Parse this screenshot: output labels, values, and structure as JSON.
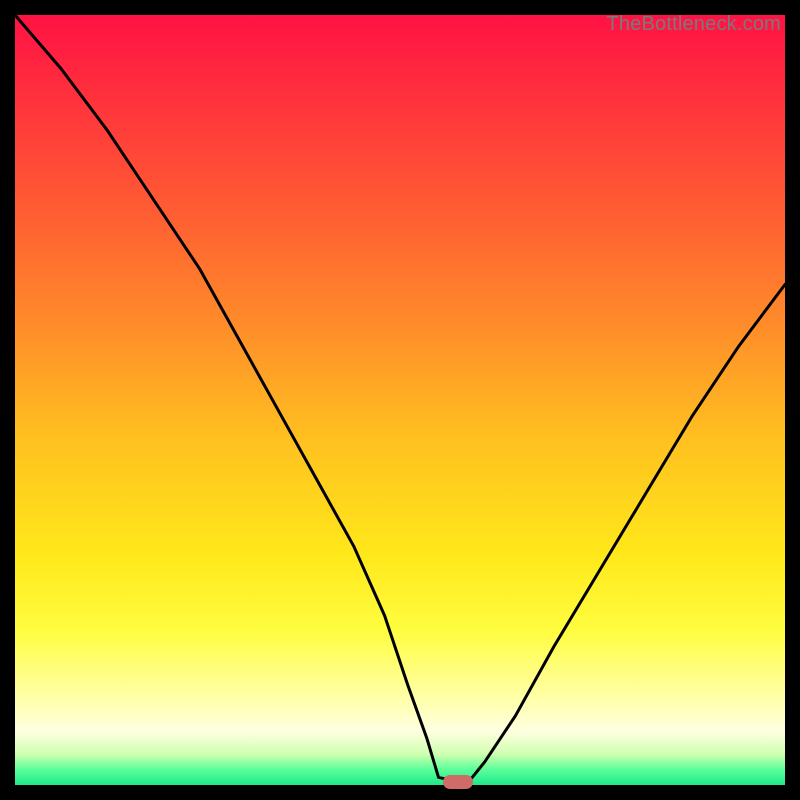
{
  "watermark": "TheBottleneck.com",
  "chart_data": {
    "type": "line",
    "title": "",
    "xlabel": "",
    "ylabel": "",
    "xlim": [
      0,
      100
    ],
    "ylim": [
      0,
      100
    ],
    "grid": false,
    "series": [
      {
        "name": "bottleneck-curve",
        "x": [
          0,
          6,
          12,
          18,
          24,
          29,
          34,
          39,
          44,
          48,
          51,
          53.5,
          55,
          57,
          59,
          61,
          65,
          70,
          76,
          82,
          88,
          94,
          100
        ],
        "values": [
          100,
          93,
          85,
          76,
          67,
          58,
          49,
          40,
          31,
          22,
          13,
          6,
          1,
          0.5,
          0.5,
          3,
          9,
          18,
          28,
          38,
          48,
          57,
          65
        ]
      }
    ],
    "marker": {
      "x": 57.5,
      "y": 0.4
    }
  },
  "colors": {
    "curve": "#000000",
    "marker": "#cf6b68",
    "frame": "#000000"
  }
}
